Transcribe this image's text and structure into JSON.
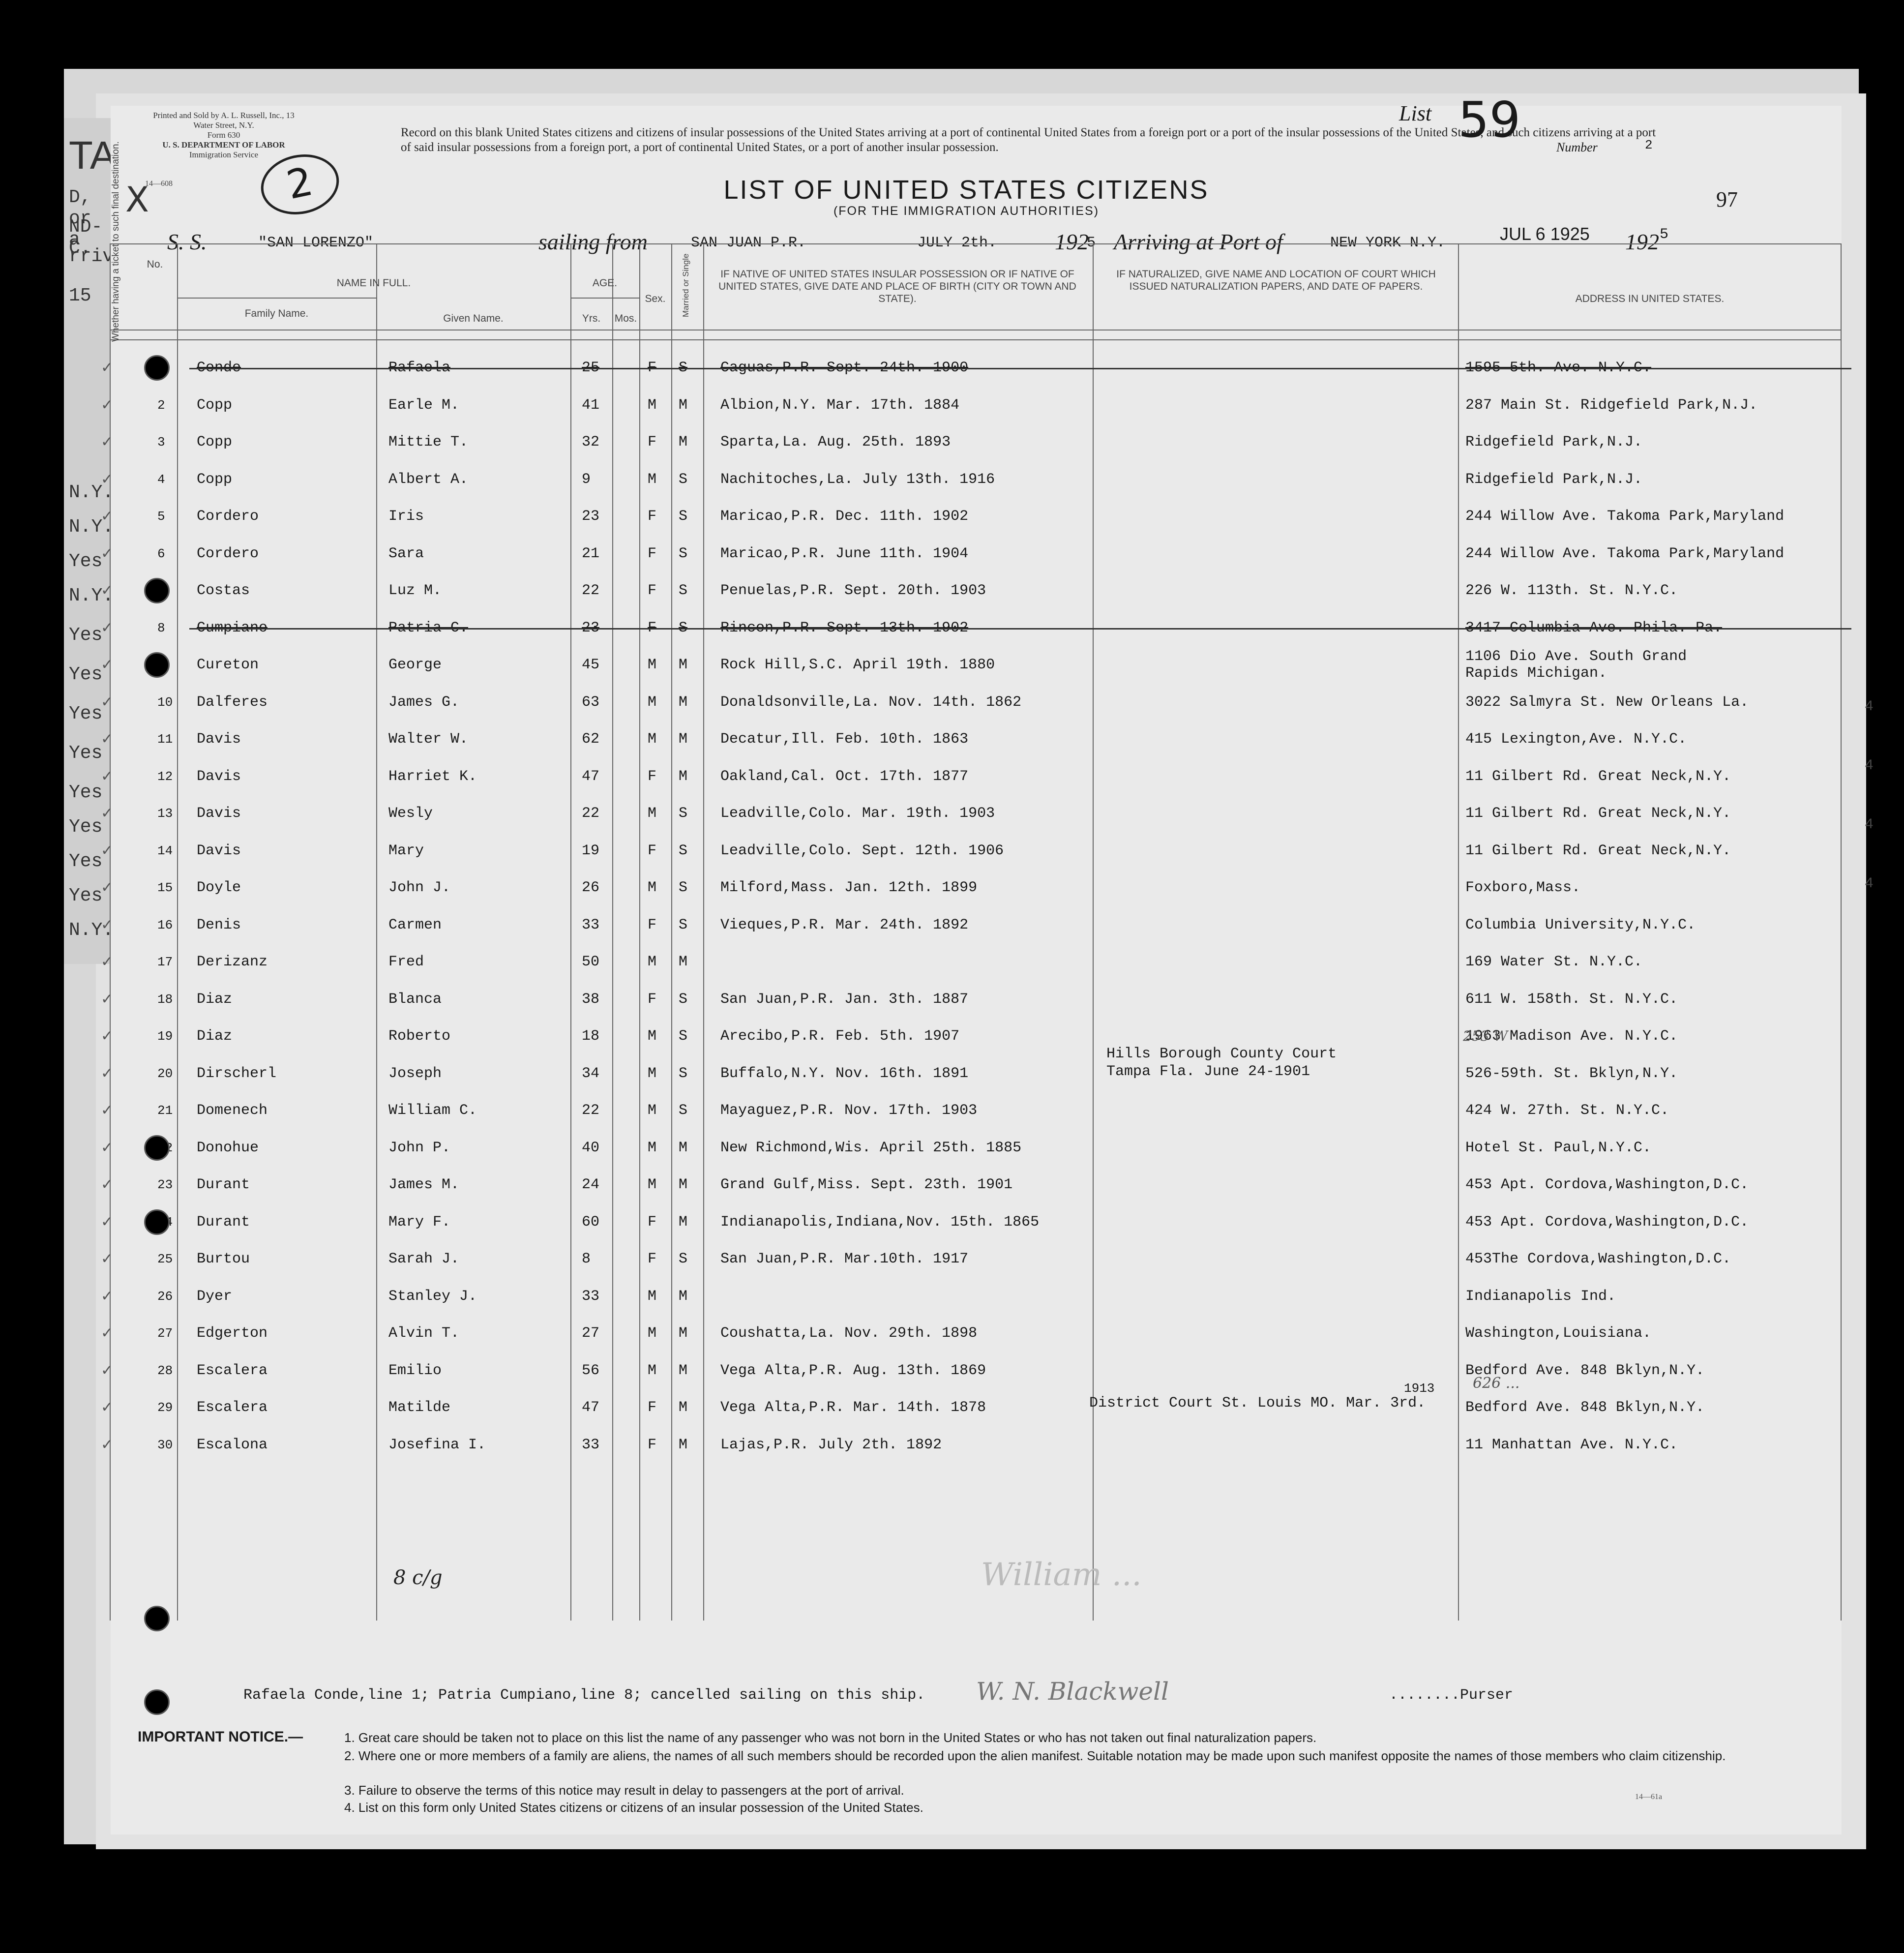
{
  "header": {
    "printer": "Printed and Sold by A. L. Russell, Inc., 13 Water Street, N.Y.",
    "form_no": "Form 630",
    "department": "U. S. DEPARTMENT OF LABOR",
    "service": "Immigration Service",
    "form_code": "14—608",
    "circled_mark": "2",
    "x_mark": "X",
    "notice": "Record on this blank United States citizens and citizens of insular possessions of the United States arriving at a port of continental United States from a foreign port or a port of the insular possessions of the United States, and such citizens arriving at a port of said insular possessions from a foreign port, a port of continental United States, or a port of another insular possession.",
    "list_label": "List",
    "list_number": "59",
    "number_label": "Number",
    "number_value": "2",
    "title": "LIST OF UNITED STATES CITIZENS",
    "subtitle": "(FOR THE IMMIGRATION AUTHORITIES)",
    "page_number": "97",
    "ss_label": "S. S.",
    "ship": "\"SAN LORENZO\"",
    "sailing_from_label": "sailing from",
    "sailing_from": "SAN JUAN P.R.",
    "sailing_date": "JULY 2th.",
    "year_prefix": "192",
    "year_suffix": "5",
    "arriving_label": "Arriving at Port of",
    "arriving_port": "NEW YORK N.Y.",
    "arrival_stamp": "JUL 6  1925",
    "arrival_year_prefix": "192",
    "arrival_year_suffix": "5"
  },
  "columns": {
    "no": "No.",
    "ticket": "Whether having a ticket to such final destination.",
    "name_in_full": "NAME IN FULL.",
    "family_name": "Family Name.",
    "given_name": "Given Name.",
    "age": "AGE.",
    "yrs": "Yrs.",
    "mos": "Mos.",
    "sex": "Sex.",
    "married": "Married or Single",
    "birth": "IF NATIVE OF UNITED STATES INSULAR POSSESSION OR IF NATIVE OF UNITED STATES, GIVE DATE AND PLACE OF BIRTH (CITY OR TOWN AND STATE).",
    "naturalized": "IF NATURALIZED, GIVE NAME AND LOCATION OF COURT WHICH ISSUED NATURALIZATION PAPERS, AND DATE OF PAPERS.",
    "address": "ADDRESS IN UNITED STATES."
  },
  "rows": [
    {
      "no": "1",
      "family": "Conde",
      "given": "Rafaela",
      "age": "25",
      "sex": "F",
      "ms": "S",
      "birth": "Caguas,P.R. Sept. 24th. 1900",
      "address": "1595 5th. Ave. N.Y.C.",
      "cancelled": true
    },
    {
      "no": "2",
      "family": "Copp",
      "given": "Earle M.",
      "age": "41",
      "sex": "M",
      "ms": "M",
      "birth": "Albion,N.Y. Mar. 17th. 1884",
      "address": "287 Main St. Ridgefield Park,N.J."
    },
    {
      "no": "3",
      "family": "Copp",
      "given": "Mittie T.",
      "age": "32",
      "sex": "F",
      "ms": "M",
      "birth": "Sparta,La. Aug. 25th. 1893",
      "address": "Ridgefield Park,N.J."
    },
    {
      "no": "4",
      "family": "Copp",
      "given": "Albert A.",
      "age": "9",
      "sex": "M",
      "ms": "S",
      "birth": "Nachitoches,La. July 13th. 1916",
      "address": "Ridgefield Park,N.J."
    },
    {
      "no": "5",
      "family": "Cordero",
      "given": "Iris",
      "age": "23",
      "sex": "F",
      "ms": "S",
      "birth": "Maricao,P.R. Dec. 11th. 1902",
      "address": "244 Willow Ave. Takoma Park,Maryland"
    },
    {
      "no": "6",
      "family": "Cordero",
      "given": "Sara",
      "age": "21",
      "sex": "F",
      "ms": "S",
      "birth": "Maricao,P.R. June 11th. 1904",
      "address": "244 Willow Ave. Takoma Park,Maryland"
    },
    {
      "no": "7",
      "family": "Costas",
      "given": "Luz M.",
      "age": "22",
      "sex": "F",
      "ms": "S",
      "birth": "Penuelas,P.R. Sept. 20th. 1903",
      "address": "226 W. 113th. St. N.Y.C."
    },
    {
      "no": "8",
      "family": "Cumpiano",
      "given": "Patria C.",
      "age": "23",
      "sex": "F",
      "ms": "S",
      "birth": "Rincon,P.R. Sept. 13th. 1902",
      "address": "3417 Columbia Ave. Phila. Pa.",
      "cancelled": true
    },
    {
      "no": "9",
      "family": "Cureton",
      "given": "George",
      "age": "45",
      "sex": "M",
      "ms": "M",
      "birth": "Rock Hill,S.C. April 19th. 1880",
      "address": "1106 Dio Ave. South  Grand",
      "address2": "Rapids Michigan."
    },
    {
      "no": "10",
      "family": "Dalferes",
      "given": "James G.",
      "age": "63",
      "sex": "M",
      "ms": "M",
      "birth": "Donaldsonville,La. Nov. 14th. 1862",
      "address": "3022 Salmyra St. New Orleans La."
    },
    {
      "no": "11",
      "family": "Davis",
      "given": "Walter W.",
      "age": "62",
      "sex": "M",
      "ms": "M",
      "birth": "Decatur,Ill. Feb. 10th. 1863",
      "address": "415 Lexington,Ave. N.Y.C."
    },
    {
      "no": "12",
      "family": "Davis",
      "given": "Harriet K.",
      "age": "47",
      "sex": "F",
      "ms": "M",
      "birth": "Oakland,Cal. Oct. 17th. 1877",
      "address": "11 Gilbert Rd. Great Neck,N.Y."
    },
    {
      "no": "13",
      "family": "Davis",
      "given": "Wesly",
      "age": "22",
      "sex": "M",
      "ms": "S",
      "birth": "Leadville,Colo. Mar. 19th. 1903",
      "address": "11 Gilbert Rd. Great Neck,N.Y."
    },
    {
      "no": "14",
      "family": "Davis",
      "given": "Mary",
      "age": "19",
      "sex": "F",
      "ms": "S",
      "birth": "Leadville,Colo. Sept. 12th. 1906",
      "address": "11 Gilbert Rd. Great Neck,N.Y."
    },
    {
      "no": "15",
      "family": "Doyle",
      "given": "John J.",
      "age": "26",
      "sex": "M",
      "ms": "S",
      "birth": "Milford,Mass. Jan. 12th. 1899",
      "address": "Foxboro,Mass."
    },
    {
      "no": "16",
      "family": "Denis",
      "given": "Carmen",
      "age": "33",
      "sex": "F",
      "ms": "S",
      "birth": "Vieques,P.R. Mar. 24th. 1892",
      "address": "Columbia University,N.Y.C."
    },
    {
      "no": "17",
      "family": "Derizanz",
      "given": "Fred",
      "age": "50",
      "sex": "M",
      "ms": "M",
      "birth": "",
      "address": "169 Water St. N.Y.C."
    },
    {
      "no": "18",
      "family": "Diaz",
      "given": "Blanca",
      "age": "38",
      "sex": "F",
      "ms": "S",
      "birth": "San Juan,P.R. Jan. 3th. 1887",
      "address": "611 W. 158th. St. N.Y.C."
    },
    {
      "no": "19",
      "family": "Diaz",
      "given": "Roberto",
      "age": "18",
      "sex": "M",
      "ms": "S",
      "birth": "Arecibo,P.R. Feb. 5th. 1907",
      "address": "1963 Madison Ave. N.Y.C."
    },
    {
      "no": "20",
      "family": "Dirscherl",
      "given": "Joseph",
      "age": "34",
      "sex": "M",
      "ms": "S",
      "birth": "Buffalo,N.Y. Nov. 16th. 1891",
      "address": "526-59th. St. Bklyn,N.Y."
    },
    {
      "no": "21",
      "family": "Domenech",
      "given": "William C.",
      "age": "22",
      "sex": "M",
      "ms": "S",
      "birth": "Mayaguez,P.R. Nov. 17th. 1903",
      "address": "424 W. 27th. St. N.Y.C."
    },
    {
      "no": "22",
      "family": "Donohue",
      "given": "John P.",
      "age": "40",
      "sex": "M",
      "ms": "M",
      "birth": "New Richmond,Wis. April 25th. 1885",
      "address": "Hotel St. Paul,N.Y.C."
    },
    {
      "no": "23",
      "family": "Durant",
      "given": "James M.",
      "age": "24",
      "sex": "M",
      "ms": "M",
      "birth": "Grand Gulf,Miss. Sept. 23th. 1901",
      "address": "453 Apt. Cordova,Washington,D.C."
    },
    {
      "no": "24",
      "family": "Durant",
      "given": "Mary F.",
      "age": "60",
      "sex": "F",
      "ms": "M",
      "birth": "Indianapolis,Indiana,Nov. 15th. 1865",
      "address": "453 Apt. Cordova,Washington,D.C."
    },
    {
      "no": "25",
      "family": "Burtou",
      "given": "Sarah J.",
      "age": "8",
      "sex": "F",
      "ms": "S",
      "birth": "San Juan,P.R. Mar.10th. 1917",
      "address": "453The Cordova,Washington,D.C."
    },
    {
      "no": "26",
      "family": "Dyer",
      "given": "Stanley J.",
      "age": "33",
      "sex": "M",
      "ms": "M",
      "birth": "",
      "address": "Indianapolis Ind."
    },
    {
      "no": "27",
      "family": "Edgerton",
      "given": "Alvin T.",
      "age": "27",
      "sex": "M",
      "ms": "M",
      "birth": "Coushatta,La. Nov. 29th. 1898",
      "address": "Washington,Louisiana."
    },
    {
      "no": "28",
      "family": "Escalera",
      "given": "Emilio",
      "age": "56",
      "sex": "M",
      "ms": "M",
      "birth": "Vega Alta,P.R. Aug. 13th. 1869",
      "address": "Bedford Ave. 848 Bklyn,N.Y."
    },
    {
      "no": "29",
      "family": "Escalera",
      "given": "Matilde",
      "age": "47",
      "sex": "F",
      "ms": "M",
      "birth": "Vega Alta,P.R. Mar. 14th. 1878",
      "address": "Bedford Ave. 848 Bklyn,N.Y."
    },
    {
      "no": "30",
      "family": "Escalona",
      "given": "Josefina I.",
      "age": "33",
      "sex": "F",
      "ms": "M",
      "birth": "Lajas,P.R. July 2th. 1892",
      "address": "11 Manhattan Ave. N.Y.C."
    }
  ],
  "naturalization": {
    "row17_line1": "Hills Borough County Court",
    "row17_line2": "Tampa Fla. June 24-1901",
    "row26": "District Court St. Louis MO. Mar. 3rd.",
    "row26_year": "1913"
  },
  "annotations": {
    "row16_hand": "253 W",
    "row25_hand": "626 ...",
    "scrawl_bottom": "8 c/g"
  },
  "left_fragments": [
    "TA",
    "D, or a",
    "ND-C.",
    "rrivi",
    "15",
    "N.Y.",
    "N.Y.",
    "Yes",
    "N.Y.",
    "Yes",
    "Yes",
    "Yes",
    "Yes",
    "Yes",
    "Yes",
    "Yes",
    "Yes",
    "N.Y."
  ],
  "right_fragments": [
    "4",
    "4",
    "4",
    "4"
  ],
  "footer": {
    "cancelled_note": "Rafaela Conde,line 1; Patria Cumpiano,line 8; cancelled sailing on this ship.",
    "purser_sig": "W. N. Blackwell",
    "purser_label": "........Purser",
    "second_sig": "William ...",
    "important_label": "IMPORTANT NOTICE.—",
    "notices": [
      "1. Great care should be taken not to place on this list the name of any passenger who was not born in the United States or who has not taken out final naturalization papers.",
      "2. Where one or more members of a family are aliens, the names of all such members should be recorded upon the alien manifest. Suitable notation may be made upon such manifest opposite the names of those members who claim citizenship.",
      "3. Failure to observe the terms of this notice may result in delay to passengers at the port of arrival.",
      "4. List on this form only United States citizens or citizens of an insular possession of the United States."
    ],
    "form_code": "14—61a"
  }
}
